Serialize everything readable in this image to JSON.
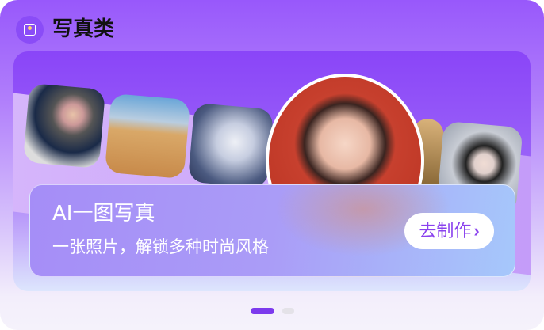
{
  "header": {
    "title": "写真类",
    "icon": "portrait-icon"
  },
  "banner": {
    "title": "AI一图写真",
    "subtitle": "一张照片，解锁多种时尚风格",
    "cta_label": "去制作",
    "cta_icon": "chevron-right-icon",
    "photos": [
      "astronaut-child",
      "desert-woman",
      "white-wolf-girl",
      "featured-red-portrait",
      "partial-photo",
      "white-hanfu-girl"
    ]
  },
  "carousel": {
    "pages": 2,
    "active": 1,
    "active_color": "#7c3aed",
    "inactive_color": "#e4e2e8"
  }
}
